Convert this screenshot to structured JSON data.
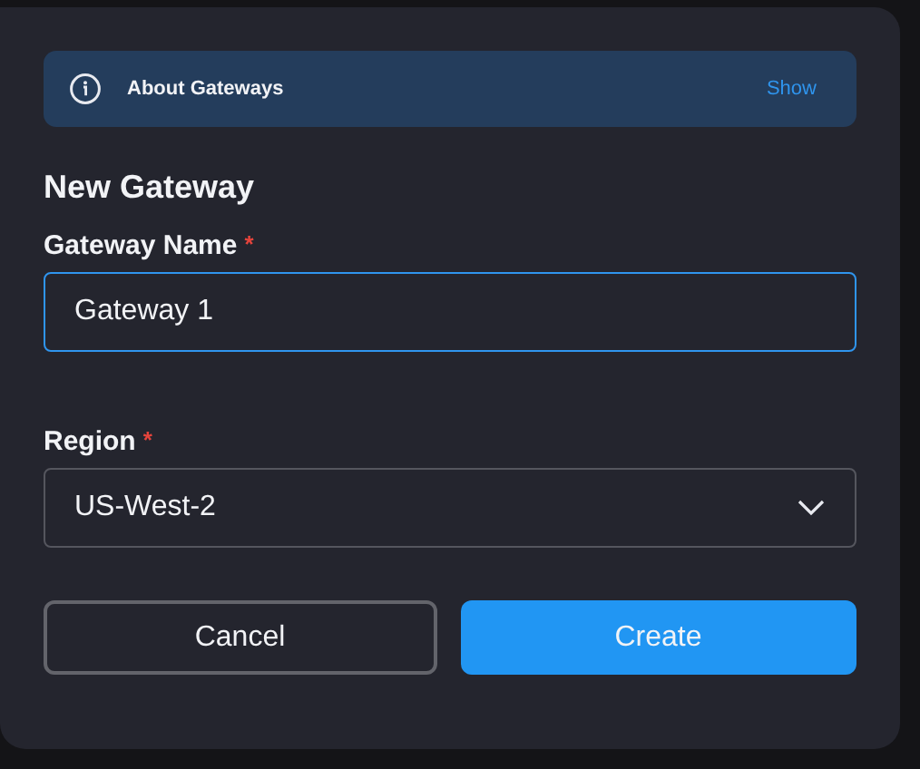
{
  "about": {
    "title": "About Gateways",
    "action": "Show"
  },
  "title": "New Gateway",
  "fields": [
    {
      "kind": "text",
      "label": "Gateway Name",
      "required_mark": "*",
      "value": "Gateway 1",
      "focused": true
    },
    {
      "kind": "select",
      "label": "Region",
      "required_mark": "*",
      "value": "US-West-2",
      "focused": false
    }
  ],
  "buttons": [
    {
      "label": "Cancel",
      "kind": "secondary"
    },
    {
      "label": "Create",
      "kind": "primary"
    }
  ]
}
